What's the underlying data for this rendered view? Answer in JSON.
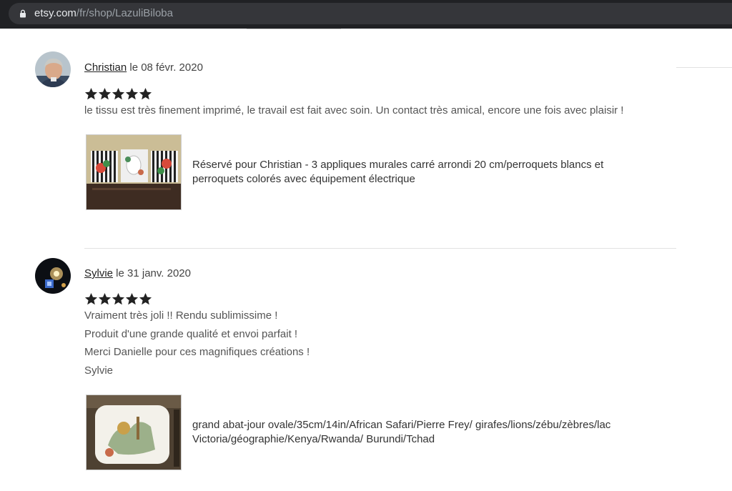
{
  "browser": {
    "url_domain": "etsy.com",
    "url_path": "/fr/shop/LazuliBiloba",
    "lock_icon": "lock-icon"
  },
  "reviews": [
    {
      "name": "Christian",
      "date_text": " le 08 févr. 2020",
      "rating": 5,
      "text_lines": [
        "le tissu est très finement imprimé, le travail est fait avec soin. Un contact très amical, encore une fois avec plaisir !"
      ],
      "item_title": "Réservé pour Christian - 3 appliques murales carré arrondi 20 cm/perroquets blancs et perroquets colorés avec équipement électrique"
    },
    {
      "name": "Sylvie",
      "date_text": " le 31 janv. 2020",
      "rating": 5,
      "text_lines": [
        "Vraiment très joli !! Rendu sublimissime !",
        "Produit d'une grande qualité et envoi parfait !",
        "Merci Danielle pour ces magnifiques créations !",
        "Sylvie"
      ],
      "item_title": "grand abat-jour ovale/35cm/14in/African Safari/Pierre Frey/ girafes/lions/zébu/zèbres/lac Victoria/géographie/Kenya/Rwanda/ Burundi/Tchad"
    }
  ],
  "colors": {
    "star": "#222222",
    "text_muted": "#555555",
    "divider": "#e2e2e2",
    "browser_bg": "#202124"
  }
}
